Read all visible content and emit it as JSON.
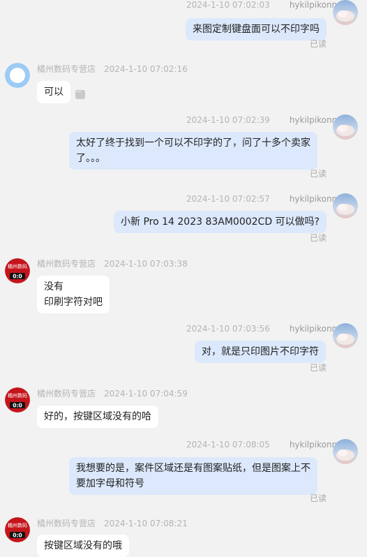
{
  "shop_name": "橘州数码专营店",
  "user_name": "hykilpikonna",
  "read_label": "已读",
  "avatar_shop_text": [
    "橘州数码",
    "0:0"
  ],
  "messages": [
    {
      "time": "2024-1-10 07:02:03",
      "text": [
        "来图定制键盘面可以不印字吗"
      ]
    },
    {
      "time": "2024-1-10 07:02:16",
      "text": [
        "可以"
      ]
    },
    {
      "time": "2024-1-10 07:02:39",
      "text": [
        "太好了终于找到一个可以不印字的了，问了十多个卖家",
        "了。。。"
      ]
    },
    {
      "time": "2024-1-10 07:02:57",
      "text": [
        "小新 Pro 14 2023 83AM0002CD 可以做吗?"
      ]
    },
    {
      "time": "2024-1-10 07:03:38",
      "text": [
        "没有",
        "印刷字符对吧"
      ]
    },
    {
      "time": "2024-1-10 07:03:56",
      "text": [
        "对，就是只印图片不印字符"
      ]
    },
    {
      "time": "2024-1-10 07:04:59",
      "text": [
        "好的，按键区域没有的哈"
      ]
    },
    {
      "time": "2024-1-10 07:08:05",
      "text": [
        "我想要的是，案件区域还是有图案贴纸，但是图案上不",
        "要加字母和符号"
      ]
    },
    {
      "time": "2024-1-10 07:08:21",
      "text": [
        "按键区域没有的哦"
      ]
    }
  ]
}
